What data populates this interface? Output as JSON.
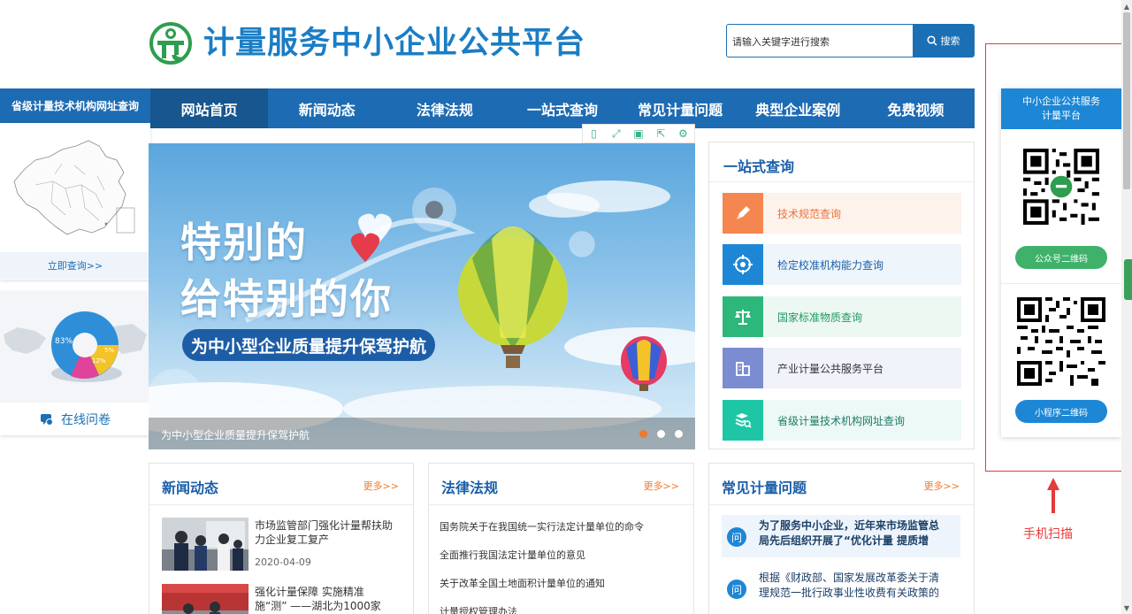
{
  "header": {
    "site_title": "计量服务中小企业公共平台",
    "search_placeholder": "请输入关键字进行搜索",
    "search_button": "搜索"
  },
  "nav": {
    "items": [
      "网站首页",
      "新闻动态",
      "法律法规",
      "一站式查询",
      "常见计量问题",
      "典型企业案例",
      "免费视频"
    ],
    "active": "网站首页"
  },
  "left_panel": {
    "title": "省级计量技术机构网址查询",
    "map_link": "立即查询>>",
    "survey_link": "在线问卷"
  },
  "banner": {
    "headline_line1": "特别的",
    "headline_line2": "给特别的你",
    "slogan": "为中小型企业质量提升保驾护航",
    "caption": "为中小型企业质量提升保驾护航",
    "slides": 3,
    "active_slide": 1
  },
  "one_stop": {
    "title": "一站式查询",
    "items": [
      {
        "label": "技术规范查询",
        "icon": "pencil-icon",
        "color": "#f5864f",
        "bg": "#fdf2ec",
        "text_color": "#e8763c"
      },
      {
        "label": "检定校准机构能力查询",
        "icon": "target-icon",
        "color": "#1d87d6",
        "bg": "#eef5fb",
        "text_color": "#1b5fa8"
      },
      {
        "label": "国家标准物质查询",
        "icon": "scales-icon",
        "color": "#2db77b",
        "bg": "#edf8f2",
        "text_color": "#1e9a63"
      },
      {
        "label": "产业计量公共服务平台",
        "icon": "building-icon",
        "color": "#7b8cd1",
        "bg": "#f1f3fb",
        "text_color": "#333333"
      },
      {
        "label": "省级计量技术机构网址查询",
        "icon": "database-search-icon",
        "color": "#1fc6a6",
        "bg": "#edf9f6",
        "text_color": "#1e7a68"
      }
    ]
  },
  "qr_panel": {
    "title_line1": "中小企业公共服务",
    "title_line2": "计量平台",
    "wechat_button": "公众号二维码",
    "miniprogram_button": "小程序二维码",
    "scan_label": "手机扫描"
  },
  "news": {
    "title": "新闻动态",
    "more": "更多>>",
    "items": [
      {
        "title": "市场监管部门强化计量帮扶助力企业复工复产",
        "date": "2020-04-09"
      },
      {
        "title": "强化计量保障 实施精准施“测” ——湖北为1000家",
        "date": ""
      }
    ]
  },
  "laws": {
    "title": "法律法规",
    "more": "更多>>",
    "items": [
      "国务院关于在我国统一实行法定计量单位的命令",
      "全面推行我国法定计量单位的意见",
      "关于改革全国土地面积计量单位的通知",
      "计量授权管理办法"
    ]
  },
  "faq": {
    "title": "常见计量问题",
    "more": "更多>>",
    "badge": "问",
    "items": [
      "为了服务中小企业，近年来市场监管总局先后组织开展了“优化计量 提质增",
      "根据《财政部、国家发展改革委关于清理规范一批行政事业性收费有关政策的"
    ]
  }
}
